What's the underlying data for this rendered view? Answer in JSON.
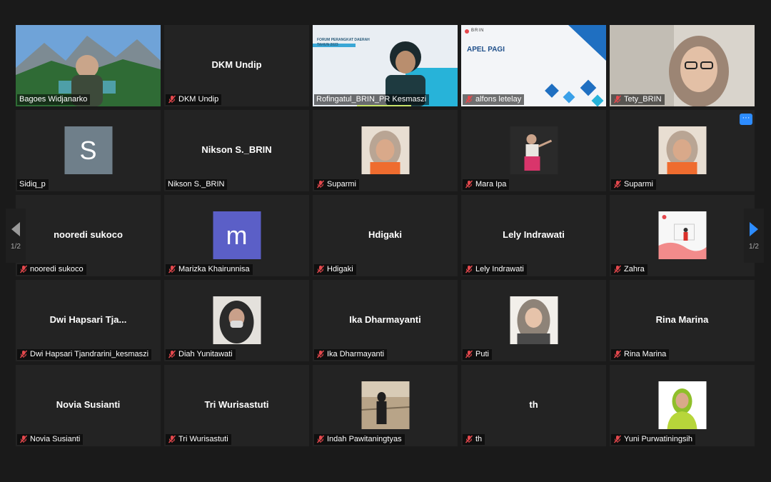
{
  "pagination": {
    "left_label": "1/2",
    "right_label": "1/2"
  },
  "tiles": [
    {
      "display": "Bagoes Widjanarko",
      "tag": "Bagoes Widjanarko"
    },
    {
      "display": "DKM Undip",
      "tag": "DKM Undip"
    },
    {
      "display": "Rofingatul_BRIN_PR Kesmaszi",
      "tag": "Rofingatul_BRIN_PR Kesmaszi",
      "slide_text": "FORUM PERANGKAT DAERAH TAHUN 2023"
    },
    {
      "display": "alfons letelay",
      "tag": "alfons letelay",
      "slide_title": "APEL PAGI",
      "slide_brand": "BRIN"
    },
    {
      "display": "Tety_BRIN",
      "tag": "Tety_BRIN"
    },
    {
      "display": "S",
      "tag": "Sidiq_p"
    },
    {
      "display": "Nikson S._BRIN",
      "tag": "Nikson S._BRIN"
    },
    {
      "display": "Suparmi",
      "tag": "Suparmi"
    },
    {
      "display": "Mara Ipa",
      "tag": "Mara Ipa"
    },
    {
      "display": "Suparmi",
      "tag": "Suparmi"
    },
    {
      "display": "nooredi sukoco",
      "tag": "nooredi sukoco"
    },
    {
      "display": "m",
      "tag": "Marizka Khairunnisa"
    },
    {
      "display": "Hdigaki",
      "tag": "Hdigaki"
    },
    {
      "display": "Lely Indrawati",
      "tag": "Lely Indrawati"
    },
    {
      "display": "Zahra",
      "tag": "Zahra"
    },
    {
      "display": "Dwi Hapsari Tja...",
      "tag": "Dwi Hapsari Tjandrarini_kesmaszi"
    },
    {
      "display": "Diah Yunitawati",
      "tag": "Diah Yunitawati"
    },
    {
      "display": "Ika Dharmayanti",
      "tag": "Ika Dharmayanti"
    },
    {
      "display": "Puti",
      "tag": "Puti"
    },
    {
      "display": "Rina Marina",
      "tag": "Rina Marina"
    },
    {
      "display": "Novia Susianti",
      "tag": "Novia Susianti"
    },
    {
      "display": "Tri Wurisastuti",
      "tag": "Tri Wurisastuti"
    },
    {
      "display": "Indah Pawitaningtyas",
      "tag": "Indah Pawitaningtyas"
    },
    {
      "display": "th",
      "tag": "th"
    },
    {
      "display": "Yuni Purwatiningsih",
      "tag": "Yuni Purwatiningsih"
    }
  ],
  "colors": {
    "active_speaker": "#c7e36a",
    "muted_icon": "#e5484d",
    "avatar_s": "#6f7f8a",
    "avatar_m": "#5b5fc7",
    "more_button": "#2d8cff",
    "arrow_left": "#9a9a9a",
    "arrow_right": "#2d8cff"
  },
  "icons": {
    "muted": "microphone-muted-icon",
    "prev": "chevron-left-icon",
    "next": "chevron-right-icon",
    "more": "more-options-icon"
  }
}
